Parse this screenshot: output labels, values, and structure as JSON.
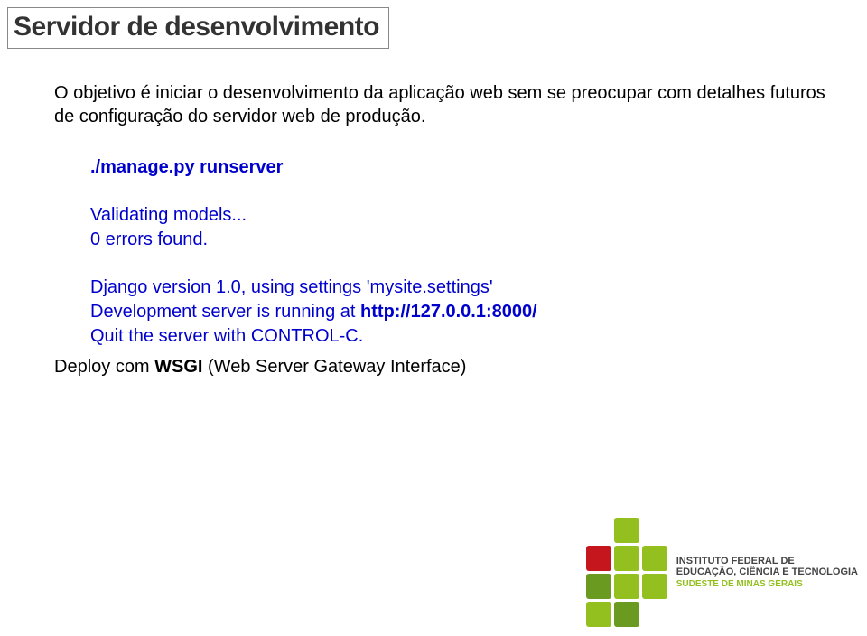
{
  "title": "Servidor de desenvolvimento",
  "intro": "O objetivo é iniciar o desenvolvimento da aplicação web sem se preocupar com detalhes futuros de configuração do servidor web de produção.",
  "code": {
    "cmd": "./manage.py runserver",
    "validating": "Validating models...",
    "errors": "0 errors found.",
    "version": "Django version 1.0, using settings 'mysite.settings'",
    "running_pre": "Development server is running at ",
    "running_url": "http://127.0.0.1:8000/",
    "quit": "Quit the server with CONTROL-C."
  },
  "footer": {
    "pre": "Deploy com ",
    "bold": "WSGI",
    "post": " (Web Server Gateway Interface)"
  },
  "logo": {
    "line1": "INSTITUTO FEDERAL DE",
    "line2": "EDUCAÇÃO, CIÊNCIA E TECNOLOGIA",
    "line3": "SUDESTE DE MINAS GERAIS"
  }
}
